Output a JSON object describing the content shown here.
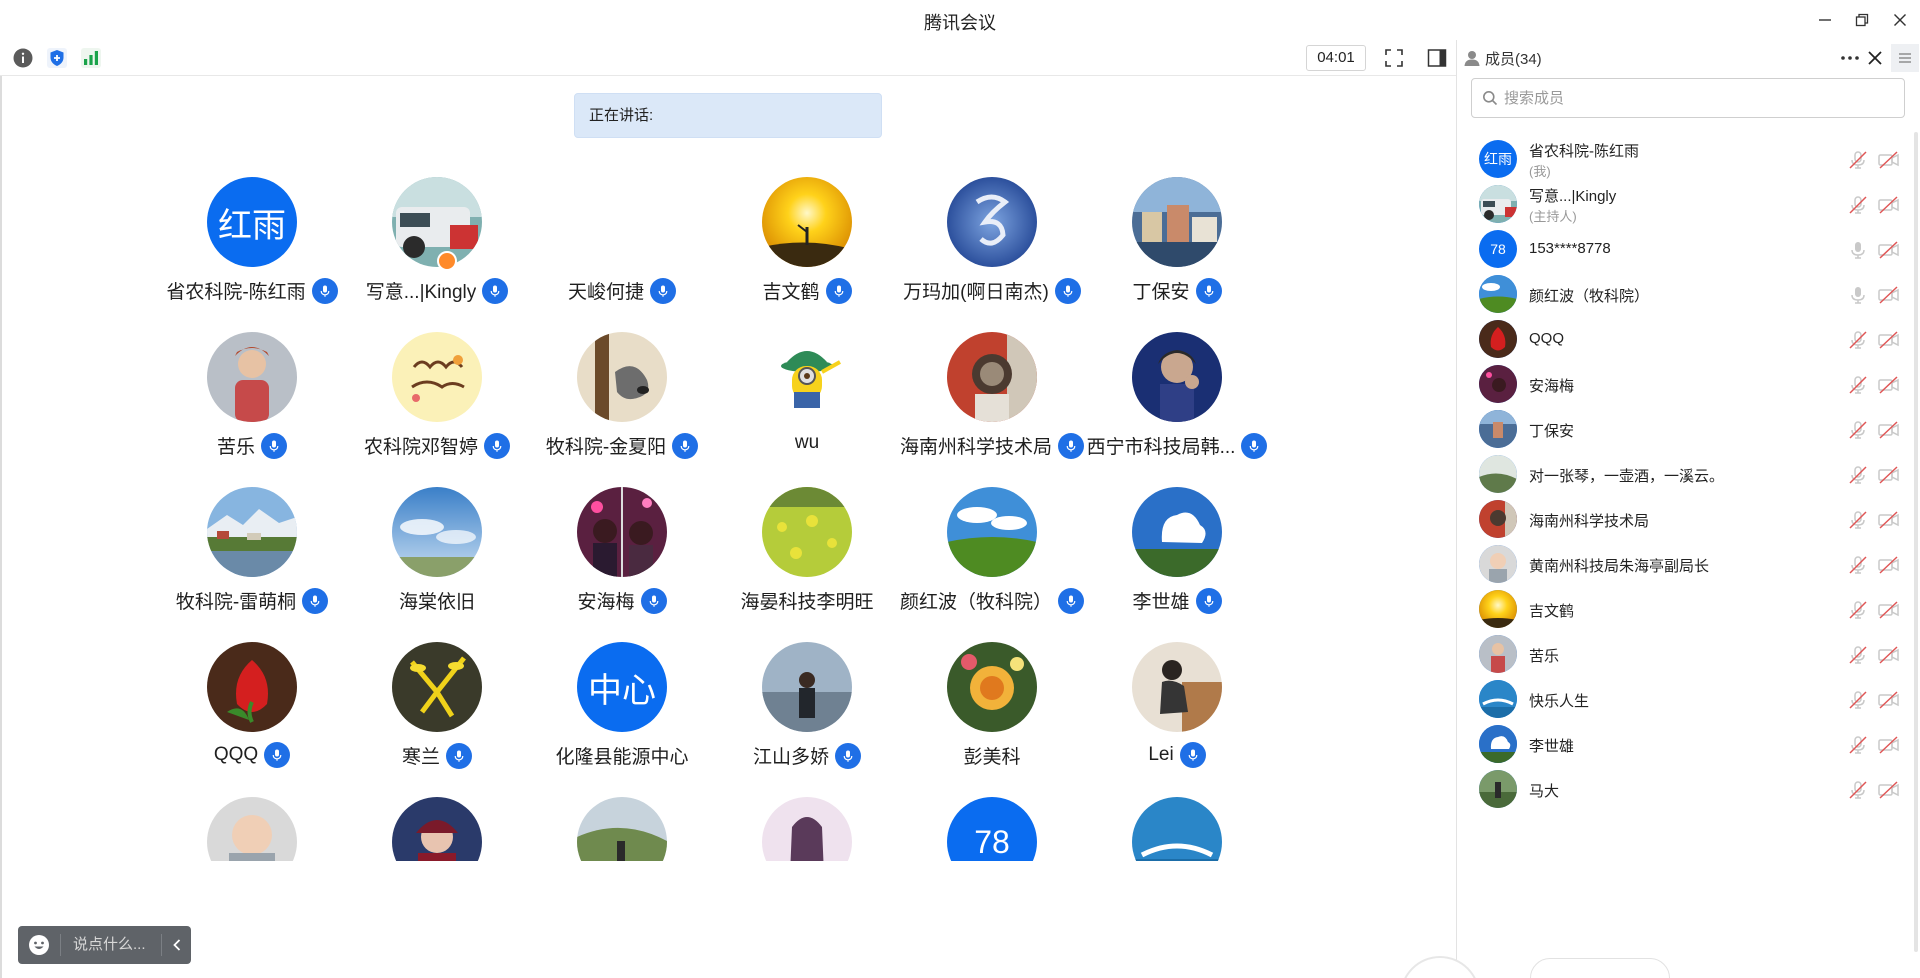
{
  "window": {
    "title": "腾讯会议"
  },
  "toolbar": {
    "timer": "04:01"
  },
  "main": {
    "speaking_label": "正在讲话:",
    "participants": [
      {
        "name": "省农科院-陈红雨",
        "avatar_text": "红雨",
        "mic": true
      },
      {
        "name": "写意...|Kingly",
        "mic": true,
        "host": true
      },
      {
        "name": "天峻何捷",
        "mic": true
      },
      {
        "name": "吉文鹤",
        "mic": true
      },
      {
        "name": "万玛加(啊日南杰)",
        "mic": true
      },
      {
        "name": "丁保安",
        "mic": true
      },
      {
        "name": "苦乐",
        "mic": true
      },
      {
        "name": "农科院邓智婷",
        "mic": true
      },
      {
        "name": "牧科院-金夏阳",
        "mic": true
      },
      {
        "name": "wu",
        "mic": false
      },
      {
        "name": "海南州科学技术局",
        "mic": true
      },
      {
        "name": "西宁市科技局韩...",
        "mic": true
      },
      {
        "name": "牧科院-雷萌桐",
        "mic": true
      },
      {
        "name": "海棠依旧",
        "mic": false
      },
      {
        "name": "安海梅",
        "mic": true
      },
      {
        "name": "海晏科技李明旺",
        "mic": false
      },
      {
        "name": "颜红波（牧科院）",
        "mic": true
      },
      {
        "name": "李世雄",
        "mic": true
      },
      {
        "name": "QQQ",
        "mic": true
      },
      {
        "name": "寒兰",
        "mic": true
      },
      {
        "name": "化隆县能源中心",
        "avatar_text": "中心",
        "mic": false
      },
      {
        "name": "江山多娇",
        "mic": true
      },
      {
        "name": "彭美科",
        "mic": false
      },
      {
        "name": "Lei",
        "mic": true
      },
      {
        "name": "",
        "mic": false
      },
      {
        "name": "",
        "mic": false
      },
      {
        "name": "",
        "mic": false
      },
      {
        "name": "",
        "mic": false
      },
      {
        "name": "",
        "avatar_text": "78",
        "mic": false
      },
      {
        "name": "",
        "mic": false
      }
    ],
    "chat_placeholder": "说点什么..."
  },
  "panel": {
    "title": "成员(34)",
    "search_placeholder": "搜索成员",
    "members": [
      {
        "name": "省农科院-陈红雨",
        "role": "(我)",
        "avatar_text": "红雨"
      },
      {
        "name": "写意...|Kingly",
        "role": "(主持人)"
      },
      {
        "name": "153****8778",
        "avatar_text": "78"
      },
      {
        "name": "颜红波（牧科院）"
      },
      {
        "name": "QQQ"
      },
      {
        "name": "安海梅"
      },
      {
        "name": "丁保安"
      },
      {
        "name": "对一张琴，一壶酒，一溪云。"
      },
      {
        "name": "海南州科学技术局"
      },
      {
        "name": "黄南州科技局朱海亭副局长"
      },
      {
        "name": "吉文鹤"
      },
      {
        "name": "苦乐"
      },
      {
        "name": "快乐人生"
      },
      {
        "name": "李世雄"
      },
      {
        "name": "马大"
      }
    ]
  },
  "colors": {
    "accent": "#0a6cf0",
    "mic_blue": "#1f6fe6",
    "muted_red": "#e05656"
  }
}
